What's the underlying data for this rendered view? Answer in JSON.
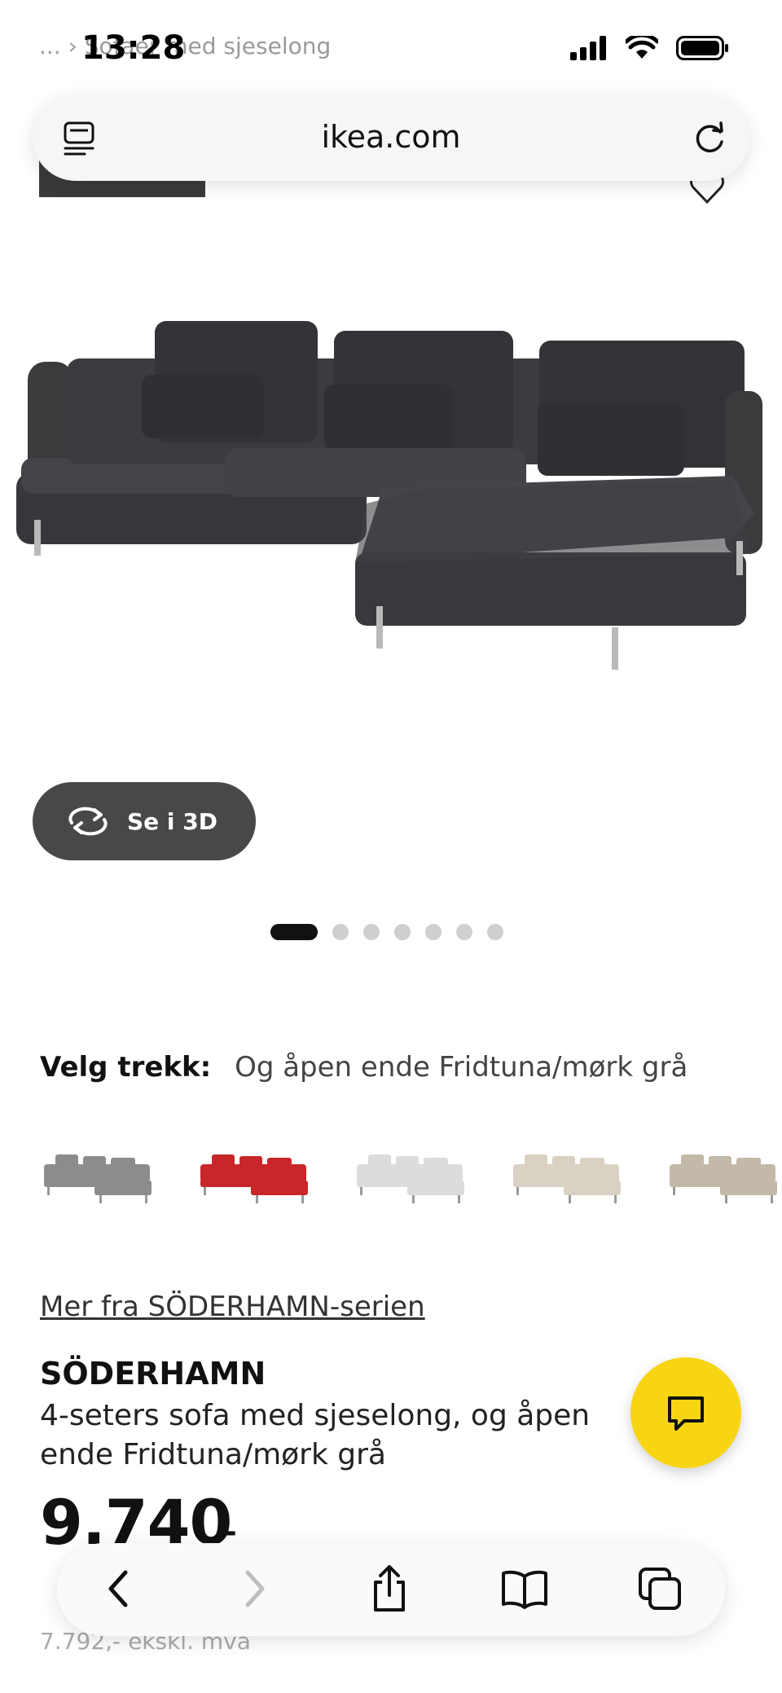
{
  "status": {
    "time": "13:28",
    "breadcrumb": "...  ›  Sofaer med sjeselong"
  },
  "browser": {
    "url": "ikea.com"
  },
  "product": {
    "view_3d_label": "Se i 3D",
    "carousel": {
      "count": 7,
      "active": 0
    },
    "velg_label": "Velg trekk:",
    "velg_value": "Og åpen ende Fridtuna/mørk grå",
    "swatches": [
      {
        "color": "#8c8c8c",
        "name": "grey"
      },
      {
        "color": "#c8262a",
        "name": "red"
      },
      {
        "color": "#dcdcda",
        "name": "light-grey"
      },
      {
        "color": "#d9d1c3",
        "name": "beige"
      },
      {
        "color": "#c3b9a8",
        "name": "dark-beige"
      }
    ],
    "series_link": "Mer fra SÖDERHAMN-serien",
    "brand": "SÖDERHAMN",
    "description": "4-seters sofa med sjeselong, og åpen ende Fridtuna/mørk grå",
    "price": "9.740",
    "price_suffix": ",-",
    "price_ex_vat": "7.792,- ekskl. mva"
  },
  "colors": {
    "accent_yellow": "#f8d513",
    "sofa": "#3a3b3d"
  }
}
